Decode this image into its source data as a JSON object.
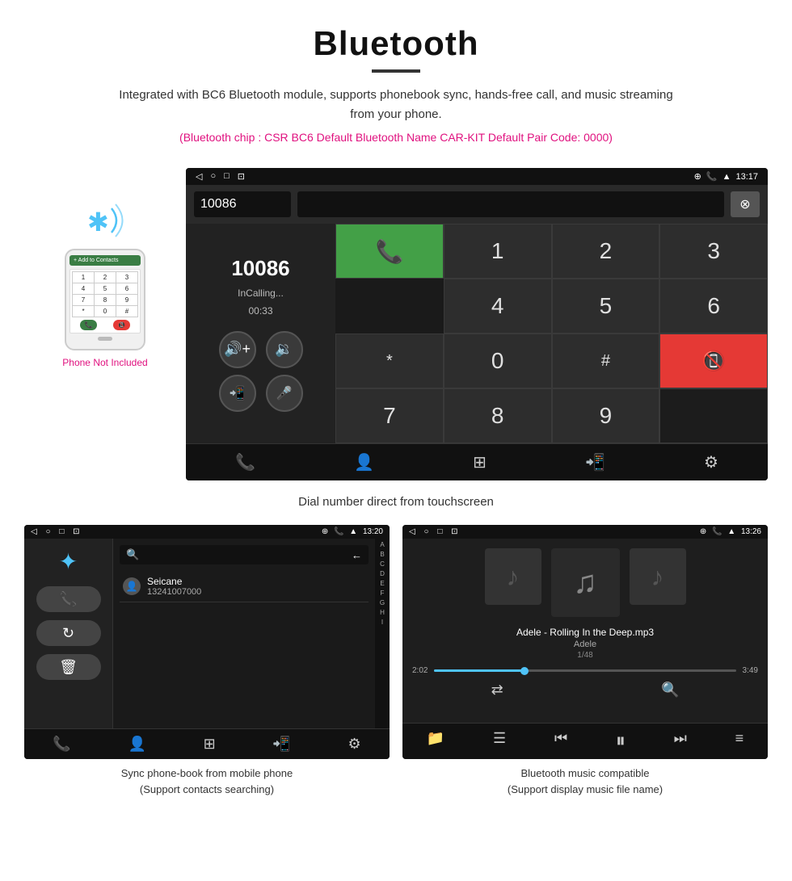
{
  "header": {
    "title": "Bluetooth",
    "description": "Integrated with BC6 Bluetooth module, supports phonebook sync, hands-free call, and music streaming from your phone.",
    "info_line": "(Bluetooth chip : CSR BC6    Default Bluetooth Name CAR-KIT    Default Pair Code: 0000)",
    "underline_color": "#333"
  },
  "phone_area": {
    "not_included_label": "Phone Not Included",
    "add_to_contacts": "+ Add to Contacts"
  },
  "dial_screen": {
    "status_time": "13:17",
    "caller_number": "10086",
    "calling_status": "InCalling...",
    "calling_timer": "00:33",
    "keypad_keys": [
      "1",
      "2",
      "3",
      "*",
      "4",
      "5",
      "6",
      "0",
      "7",
      "8",
      "9",
      "#"
    ],
    "caption": "Dial number direct from touchscreen"
  },
  "phonebook_screen": {
    "status_time": "13:20",
    "contact_name": "Seicane",
    "contact_number": "13241007000",
    "alpha_list": [
      "A",
      "B",
      "C",
      "D",
      "E",
      "F",
      "G",
      "H",
      "I"
    ],
    "caption_line1": "Sync phone-book from mobile phone",
    "caption_line2": "(Support contacts searching)"
  },
  "music_screen": {
    "status_time": "13:26",
    "song_title": "Adele - Rolling In the Deep.mp3",
    "artist": "Adele",
    "track_num": "1/48",
    "current_time": "2:02",
    "total_time": "3:49",
    "caption_line1": "Bluetooth music compatible",
    "caption_line2": "(Support display music file name)"
  },
  "icons": {
    "back_arrow": "◁",
    "home_circle": "○",
    "recents_square": "□",
    "screenshot": "⊡",
    "location": "⊕",
    "phone": "📞",
    "signal": "▲",
    "volume_up": "🔊",
    "volume_down": "🔉",
    "transfer": "📲",
    "mic": "🎤",
    "call_transfer": "📲",
    "contacts": "👤",
    "dialpad": "⊞",
    "settings": "⚙",
    "bluetooth_sym": "✦",
    "search": "🔍",
    "delete": "⌫",
    "shuffle": "⇄",
    "prev": "⏮",
    "play_pause": "⏸",
    "next": "⏭",
    "equalizer": "≡",
    "folder": "📁",
    "list": "☰",
    "music_note": "♪"
  }
}
